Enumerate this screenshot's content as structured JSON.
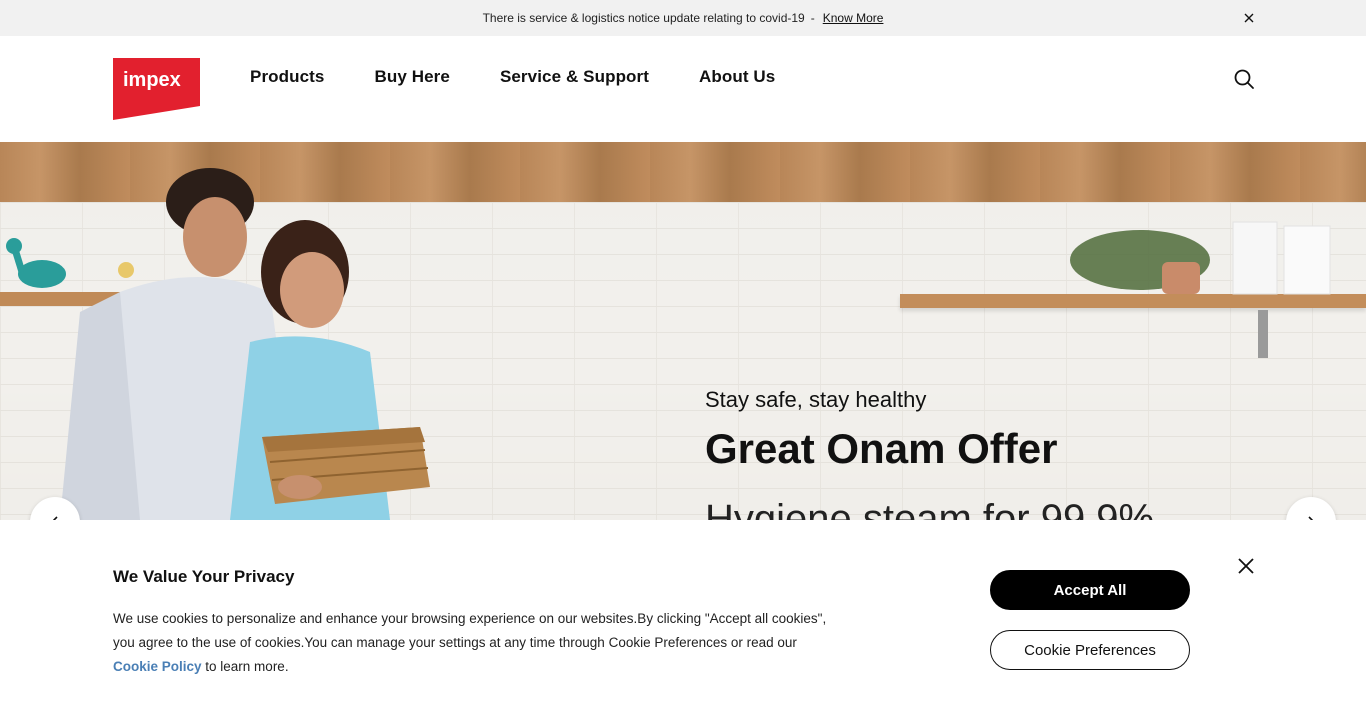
{
  "notice": {
    "text": "There is service & logistics notice update relating to covid-19",
    "separator": "-",
    "link": "Know More",
    "close_icon": "close-icon"
  },
  "header": {
    "logo_text": "impex",
    "nav": [
      "Products",
      "Buy Here",
      "Service & Support",
      "About Us"
    ],
    "search_icon": "search-icon"
  },
  "hero": {
    "subtitle": "Stay safe, stay healthy",
    "title": "Great Onam Offer",
    "description": "Hygiene steam for 99.9%",
    "prev_icon": "chevron-left-icon",
    "next_icon": "chevron-right-icon"
  },
  "cookie": {
    "title": "We Value Your Privacy",
    "text_line1": "We use cookies to personalize and enhance your browsing experience on our websites.By clicking \"Accept all cookies\",",
    "text_line2": "you agree to the use of cookies.You can manage your settings at any time through Cookie Preferences or read our",
    "policy_link": "Cookie Policy",
    "text_tail": " to learn more.",
    "accept_label": "Accept All",
    "preferences_label": "Cookie Preferences",
    "close_icon": "close-icon"
  },
  "colors": {
    "brand_red": "#e2202e",
    "link_blue": "#4a7fb5",
    "notice_bg": "#f1f1f1"
  }
}
